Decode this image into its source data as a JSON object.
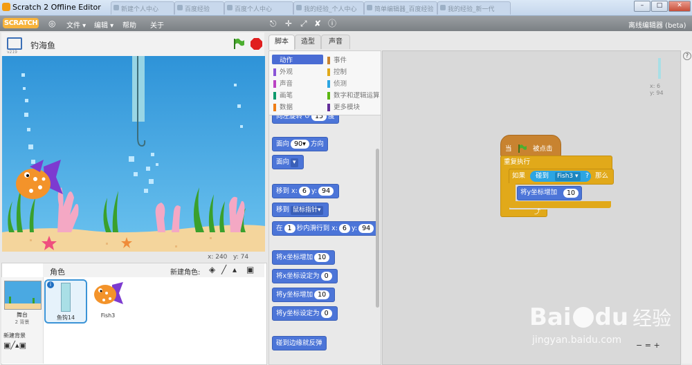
{
  "window": {
    "title": "Scratch 2 Offline Editor",
    "tabs": [
      "新建个人中心",
      "百度经验",
      "百度个人中心",
      "我的经验_个人中心",
      "简单编辑器_百度经验",
      "我的经验_新一代"
    ],
    "controls": {
      "minimize": "–",
      "maximize": "□",
      "close": "✕"
    }
  },
  "menubar": {
    "logo": "SCRATCH",
    "items": [
      {
        "label": "文件",
        "caret": true
      },
      {
        "label": "编辑",
        "caret": true
      },
      {
        "label": "帮助",
        "caret": false
      },
      {
        "label": "关于",
        "caret": false
      }
    ],
    "tools": [
      "globe-icon",
      "duplicate-stamp-icon",
      "cut-icon",
      "grow-icon",
      "shrink-icon",
      "help-icon"
    ],
    "offline_label": "离线编辑器 (beta)"
  },
  "stage": {
    "project_name": "钓海鱼",
    "version": "v219",
    "mouse_x_label": "x:",
    "mouse_x": "240",
    "mouse_y_label": "y:",
    "mouse_y": "74",
    "colors": {
      "water": "#4aa9e2",
      "sand": "#f6d9a4"
    }
  },
  "sprites_panel": {
    "title": "角色",
    "new_sprite_label": "新建角色:",
    "stage_thumb": {
      "label": "舞台",
      "backdrops": "2 背景"
    },
    "new_backdrop_label": "新建背景",
    "sprites": [
      {
        "name": "鱼钩14",
        "selected": true
      },
      {
        "name": "Fish3",
        "selected": false
      }
    ]
  },
  "tabs": [
    {
      "label": "脚本",
      "active": true
    },
    {
      "label": "造型",
      "active": false
    },
    {
      "label": "声音",
      "active": false
    }
  ],
  "categories": [
    {
      "label": "动作",
      "color": "#4a6cd4",
      "selected": true
    },
    {
      "label": "事件",
      "color": "#c88330",
      "selected": false
    },
    {
      "label": "外观",
      "color": "#8a55d7",
      "selected": false
    },
    {
      "label": "控制",
      "color": "#e1a91a",
      "selected": false
    },
    {
      "label": "声音",
      "color": "#bb42c3",
      "selected": false
    },
    {
      "label": "侦测",
      "color": "#2ca5e2",
      "selected": false
    },
    {
      "label": "画笔",
      "color": "#0e9a6c",
      "selected": false
    },
    {
      "label": "数字和逻辑运算",
      "color": "#5cb712",
      "selected": false
    },
    {
      "label": "数据",
      "color": "#ee7d16",
      "selected": false
    },
    {
      "label": "更多模块",
      "color": "#632d99",
      "selected": false
    }
  ],
  "palette_blocks": {
    "cut_top": {
      "text": "向左旋转 ↺",
      "value": "15",
      "unit": "度"
    },
    "point_dir": {
      "text": "面向",
      "value": "90▾",
      "unit": "方向"
    },
    "point_towards": {
      "text": "面向",
      "drop": "▾"
    },
    "go_xy": {
      "text": "移到 x:",
      "x": "6",
      "ylabel": "y:",
      "y": "94"
    },
    "go_to": {
      "text": "移到",
      "drop": "鼠标指针▾"
    },
    "glide": {
      "text": "在",
      "secs": "1",
      "mid": "秒内滑行到 x:",
      "x": "6",
      "ylabel": "y:",
      "y": "94"
    },
    "change_x": {
      "text": "将x坐标增加",
      "value": "10"
    },
    "set_x": {
      "text": "将x坐标设定为",
      "value": "0"
    },
    "change_y": {
      "text": "将y坐标增加",
      "value": "10"
    },
    "set_y": {
      "text": "将y坐标设定为",
      "value": "0"
    },
    "bounce": {
      "text": "碰到边缘就反弹"
    }
  },
  "script_area": {
    "sprite_x_label": "x: 6",
    "sprite_y_label": "y: 94",
    "script": {
      "hat": {
        "prefix": "当",
        "suffix": "被点击"
      },
      "forever": "重复执行",
      "if": {
        "prefix": "如果",
        "sense": "碰到",
        "target": "Fish3",
        "drop": "▾",
        "q": "?",
        "then": "那么"
      },
      "inner": {
        "text": "将y坐标增加",
        "value": "10"
      },
      "loop_arrow": "⤴"
    },
    "zoom": {
      "out": "−",
      "reset": "=",
      "in": "+"
    }
  },
  "watermark": {
    "brand": "Bai",
    "brand2": "du",
    "brand3": "经验",
    "url": "jingyan.baidu.com"
  }
}
